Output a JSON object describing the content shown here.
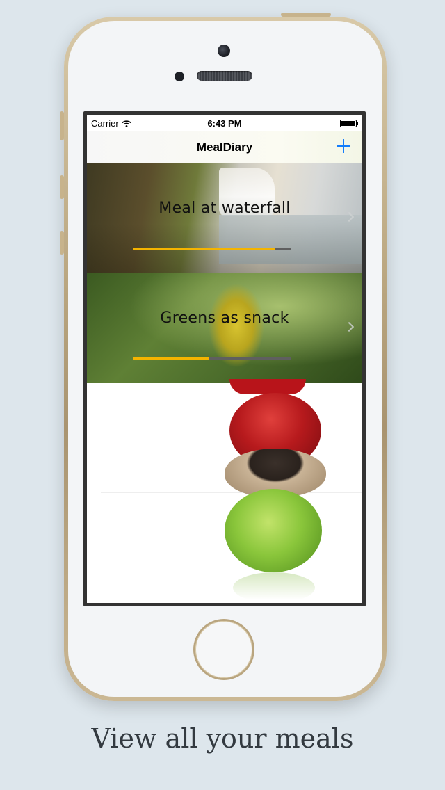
{
  "status_bar": {
    "carrier": "Carrier",
    "time": "6:43 PM"
  },
  "nav_bar": {
    "title": "MealDiary",
    "add_icon": "plus-icon"
  },
  "meals": [
    {
      "name": "Meal at waterfall",
      "rating_fraction": 0.9
    },
    {
      "name": "Greens as snack",
      "rating_fraction": 0.48
    },
    {
      "name": "",
      "rating_fraction": null
    }
  ],
  "caption": "View all your meals",
  "colors": {
    "accent": "#157efb",
    "rating": "#f4b400",
    "background": "#dde6ec"
  }
}
